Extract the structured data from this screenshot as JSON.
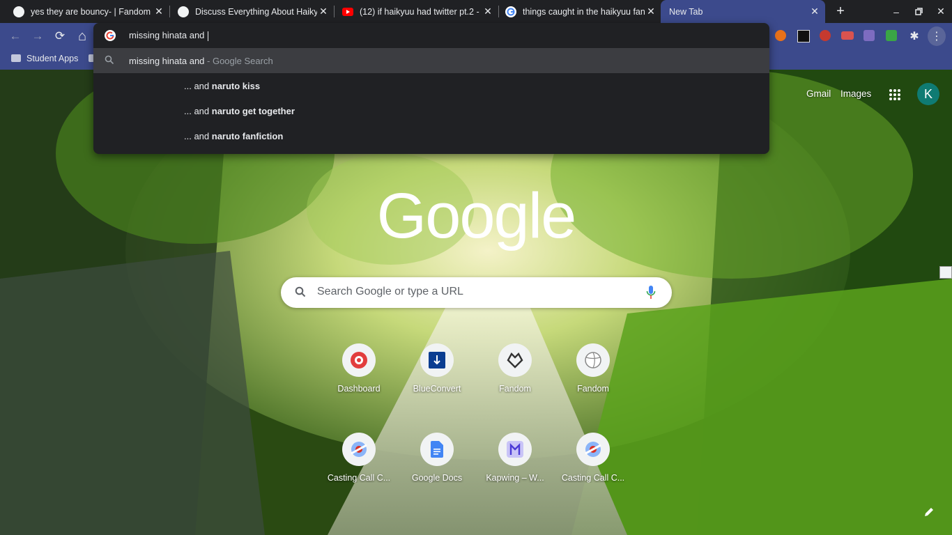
{
  "tabs": [
    {
      "title": "yes they are bouncy- | Fandom",
      "icon": "fandom-icon"
    },
    {
      "title": "Discuss Everything About Haikyu",
      "icon": "fandom-icon"
    },
    {
      "title": "(12) if haikyuu had twitter pt.2 -",
      "icon": "youtube-icon"
    },
    {
      "title": "things caught in the haikyuu fan",
      "icon": "google-icon"
    },
    {
      "title": "New Tab",
      "icon": ""
    }
  ],
  "toolbar": {
    "back_icon": "←",
    "forward_icon": "→",
    "reload_icon": "⟳",
    "home_icon": "⌂"
  },
  "omnibox": {
    "value": "missing hinata and ",
    "suggestions": [
      {
        "prefix": "missing hinata and",
        "suffix": " - Google Search"
      },
      {
        "prefix": "... and ",
        "bold": "naruto kiss"
      },
      {
        "prefix": "... and ",
        "bold": "naruto get together"
      },
      {
        "prefix": "... and ",
        "bold": "naruto fanfiction"
      }
    ]
  },
  "bookmarks": [
    {
      "label": "Student Apps"
    }
  ],
  "header": {
    "gmail": "Gmail",
    "images": "Images",
    "avatar_initial": "K"
  },
  "logo": "Google",
  "search": {
    "placeholder": "Search Google or type a URL"
  },
  "shortcuts": [
    {
      "label": "Dashboard",
      "icon": "dashboard-icon"
    },
    {
      "label": "BlueConvert",
      "icon": "blueconvert-icon"
    },
    {
      "label": "Fandom",
      "icon": "fandom-heart-icon"
    },
    {
      "label": "Fandom",
      "icon": "volleyball-icon"
    },
    {
      "label": "Casting Call C...",
      "icon": "castingcall-icon"
    },
    {
      "label": "Google Docs",
      "icon": "docs-icon"
    },
    {
      "label": "Kapwing – W...",
      "icon": "kapwing-icon"
    },
    {
      "label": "Casting Call C...",
      "icon": "castingcall-icon"
    }
  ],
  "colors": {
    "frame": "#3c4a8c",
    "tabstrip": "#202124",
    "omnibox_bg": "#202124",
    "avatar": "#0f7b73"
  }
}
